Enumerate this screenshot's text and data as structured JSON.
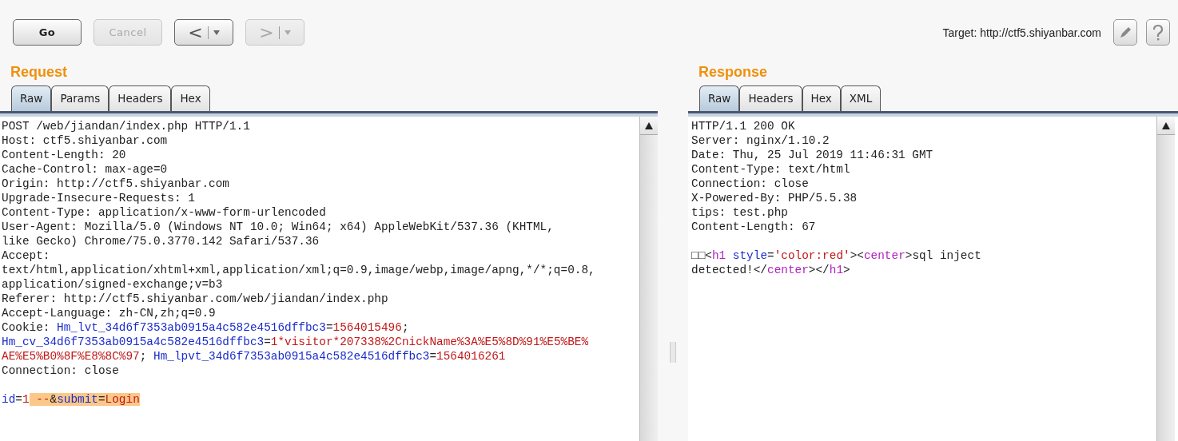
{
  "toolbar": {
    "buttons": [
      {
        "kind": "text",
        "label": "Go",
        "disabled": false
      },
      {
        "kind": "text",
        "label": "Cancel",
        "disabled": true
      },
      {
        "kind": "history",
        "label": "<",
        "disabled": false
      },
      {
        "kind": "history",
        "label": ">",
        "disabled": true
      }
    ],
    "target": "Target: http://ctf5.shiyanbar.com"
  },
  "panes": [
    {
      "title": "Request",
      "tabs": [
        {
          "label": "Raw",
          "selected": true
        },
        {
          "label": "Params",
          "selected": false
        },
        {
          "label": "Headers",
          "selected": false
        },
        {
          "label": "Hex",
          "selected": false
        }
      ],
      "headers": [
        [
          {
            "kind": "plain",
            "text": "POST /web/jiandan/index.php HTTP/1.1"
          }
        ],
        [
          {
            "kind": "plain",
            "text": "Host: ctf5.shiyanbar.com"
          }
        ],
        [
          {
            "kind": "plain",
            "text": "Content-Length: 20"
          }
        ],
        [
          {
            "kind": "plain",
            "text": "Cache-Control: max-age=0"
          }
        ],
        [
          {
            "kind": "plain",
            "text": "Origin: http://ctf5.shiyanbar.com"
          }
        ],
        [
          {
            "kind": "plain",
            "text": "Upgrade-Insecure-Requests: 1"
          }
        ],
        [
          {
            "kind": "plain",
            "text": "Content-Type: application/x-www-form-urlencoded"
          }
        ],
        [
          {
            "kind": "plain",
            "text": "User-Agent: Mozilla/5.0 (Windows NT 10.0; Win64; x64) AppleWebKit/537.36 (KHTML,"
          }
        ],
        [
          {
            "kind": "plain",
            "text": "like Gecko) Chrome/75.0.3770.142 Safari/537.36"
          }
        ],
        [
          {
            "kind": "plain",
            "text": "Accept:"
          }
        ],
        [
          {
            "kind": "plain",
            "text": "text/html,application/xhtml+xml,application/xml;q=0.9,image/webp,image/apng,*/*;q=0.8,"
          }
        ],
        [
          {
            "kind": "plain",
            "text": "application/signed-exchange;v=b3"
          }
        ],
        [
          {
            "kind": "plain",
            "text": "Referer: http://ctf5.shiyanbar.com/web/jiandan/index.php"
          }
        ],
        [
          {
            "kind": "plain",
            "text": "Accept-Language: zh-CN,zh;q=0.9"
          }
        ],
        [
          {
            "kind": "plain",
            "text": "Cookie: "
          },
          {
            "kind": "name",
            "text": "Hm_lvt_34d6f7353ab0915a4c582e4516dffbc3"
          },
          {
            "kind": "plain",
            "text": "="
          },
          {
            "kind": "value",
            "text": "1564015496"
          },
          {
            "kind": "plain",
            "text": ";"
          }
        ],
        [
          {
            "kind": "name",
            "text": "Hm_cv_34d6f7353ab0915a4c582e4516dffbc3"
          },
          {
            "kind": "plain",
            "text": "="
          },
          {
            "kind": "value",
            "text": "1*visitor*207338%2CnickName%3A%E5%8D%91%E5%BE%"
          }
        ],
        [
          {
            "kind": "value",
            "text": "AE%E5%B0%8F%E8%8C%97"
          },
          {
            "kind": "plain",
            "text": "; "
          },
          {
            "kind": "name",
            "text": "Hm_lpvt_34d6f7353ab0915a4c582e4516dffbc3"
          },
          {
            "kind": "plain",
            "text": "="
          },
          {
            "kind": "value",
            "text": "1564016261"
          }
        ],
        [
          {
            "kind": "plain",
            "text": "Connection: close"
          }
        ]
      ],
      "body": [
        [
          {
            "kind": "name",
            "text": "id"
          },
          {
            "kind": "plain",
            "text": "="
          },
          {
            "kind": "value",
            "text": "1"
          },
          {
            "kind": "value",
            "text": " --",
            "highlighted": true
          },
          {
            "kind": "plain",
            "text": "&",
            "highlighted": true
          },
          {
            "kind": "name",
            "text": "submit",
            "highlighted": true
          },
          {
            "kind": "plain",
            "text": "=",
            "highlighted": true
          },
          {
            "kind": "value",
            "text": "Login",
            "highlighted": true
          }
        ]
      ]
    },
    {
      "title": "Response",
      "tabs": [
        {
          "label": "Raw",
          "selected": true
        },
        {
          "label": "Headers",
          "selected": false
        },
        {
          "label": "Hex",
          "selected": false
        },
        {
          "label": "XML",
          "selected": false
        }
      ],
      "headers": [
        [
          {
            "kind": "plain",
            "text": "HTTP/1.1 200 OK"
          }
        ],
        [
          {
            "kind": "plain",
            "text": "Server: nginx/1.10.2"
          }
        ],
        [
          {
            "kind": "plain",
            "text": "Date: Thu, 25 Jul 2019 11:46:31 GMT"
          }
        ],
        [
          {
            "kind": "plain",
            "text": "Content-Type: text/html"
          }
        ],
        [
          {
            "kind": "plain",
            "text": "Connection: close"
          }
        ],
        [
          {
            "kind": "plain",
            "text": "X-Powered-By: PHP/5.5.38"
          }
        ],
        [
          {
            "kind": "plain",
            "text": "tips: test.php"
          }
        ],
        [
          {
            "kind": "plain",
            "text": "Content-Length: 67"
          }
        ]
      ],
      "body": [
        [
          {
            "kind": "plain",
            "text": "□□<"
          },
          {
            "kind": "tag",
            "text": "h1"
          },
          {
            "kind": "attr",
            "text": " style"
          },
          {
            "kind": "plain",
            "text": "="
          },
          {
            "kind": "value",
            "text": "'color:red'"
          },
          {
            "kind": "plain",
            "text": "><"
          },
          {
            "kind": "tag",
            "text": "center"
          },
          {
            "kind": "plain",
            "text": ">sql inject"
          }
        ],
        [
          {
            "kind": "plain",
            "text": "detected!</"
          },
          {
            "kind": "tag",
            "text": "center"
          },
          {
            "kind": "plain",
            "text": "></"
          },
          {
            "kind": "tag",
            "text": "h1"
          },
          {
            "kind": "plain",
            "text": ">"
          }
        ]
      ]
    }
  ]
}
